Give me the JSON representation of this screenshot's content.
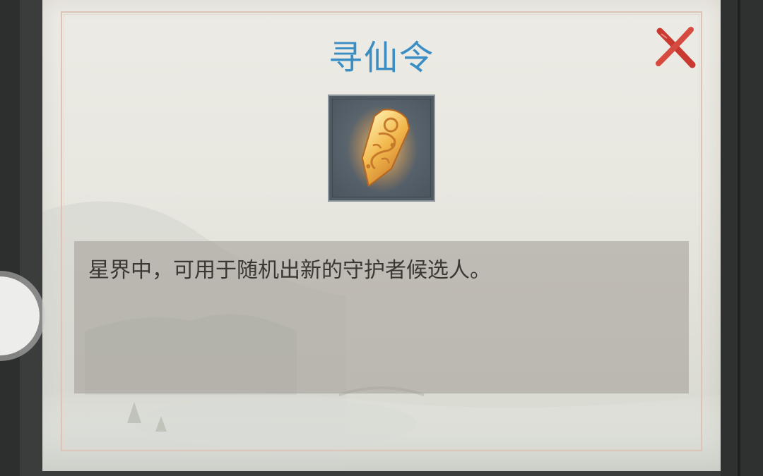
{
  "dialog": {
    "title": "寻仙令",
    "item_icon": "golden-jade-token-icon",
    "description": "星界中，可用于随机出新的守护者候选人。",
    "close_icon": "close-x-icon"
  },
  "colors": {
    "title": "#3a8ec4",
    "close": "#d0433a",
    "panel_bg": "#e8e7e0",
    "desc_box": "#a09a94",
    "item_bg": "#55606a",
    "token_gold": "#f0b640"
  }
}
